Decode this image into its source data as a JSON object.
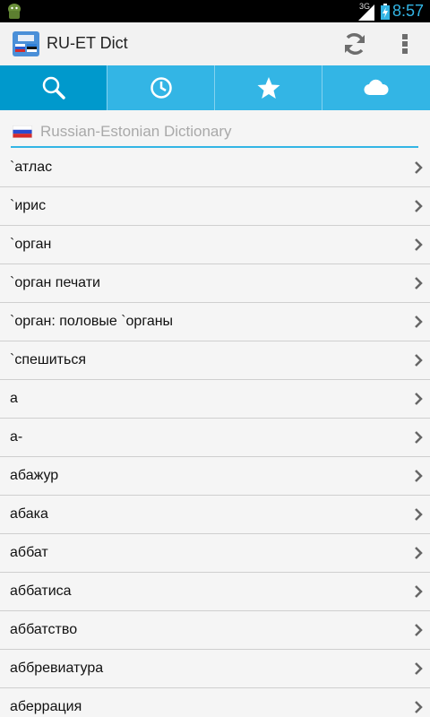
{
  "status_bar": {
    "network": "3G",
    "time": "8:57"
  },
  "app": {
    "title": "RU-ET Dict"
  },
  "icons": {
    "refresh": "refresh-icon",
    "overflow": "overflow-menu-icon",
    "search": "search-icon",
    "history": "clock-icon",
    "favorites": "star-icon",
    "cloud": "cloud-icon",
    "chevron": "chevron-right-icon"
  },
  "colors": {
    "accent": "#33b5e5",
    "accent_dark": "#0099cc"
  },
  "tabs": [
    {
      "icon": "search-icon",
      "active": true
    },
    {
      "icon": "clock-icon",
      "active": false
    },
    {
      "icon": "star-icon",
      "active": false
    },
    {
      "icon": "cloud-icon",
      "active": false
    }
  ],
  "search": {
    "placeholder": "Russian-Estonian Dictionary",
    "value": ""
  },
  "list": {
    "items": [
      "`атлас",
      "`ирис",
      "`орган",
      "`орган печати",
      "`орган: половые `органы",
      "`спешиться",
      "а",
      "а-",
      "абажур",
      "абака",
      "аббат",
      "аббатиса",
      "аббатство",
      "аббревиатура",
      "аберрация"
    ]
  }
}
